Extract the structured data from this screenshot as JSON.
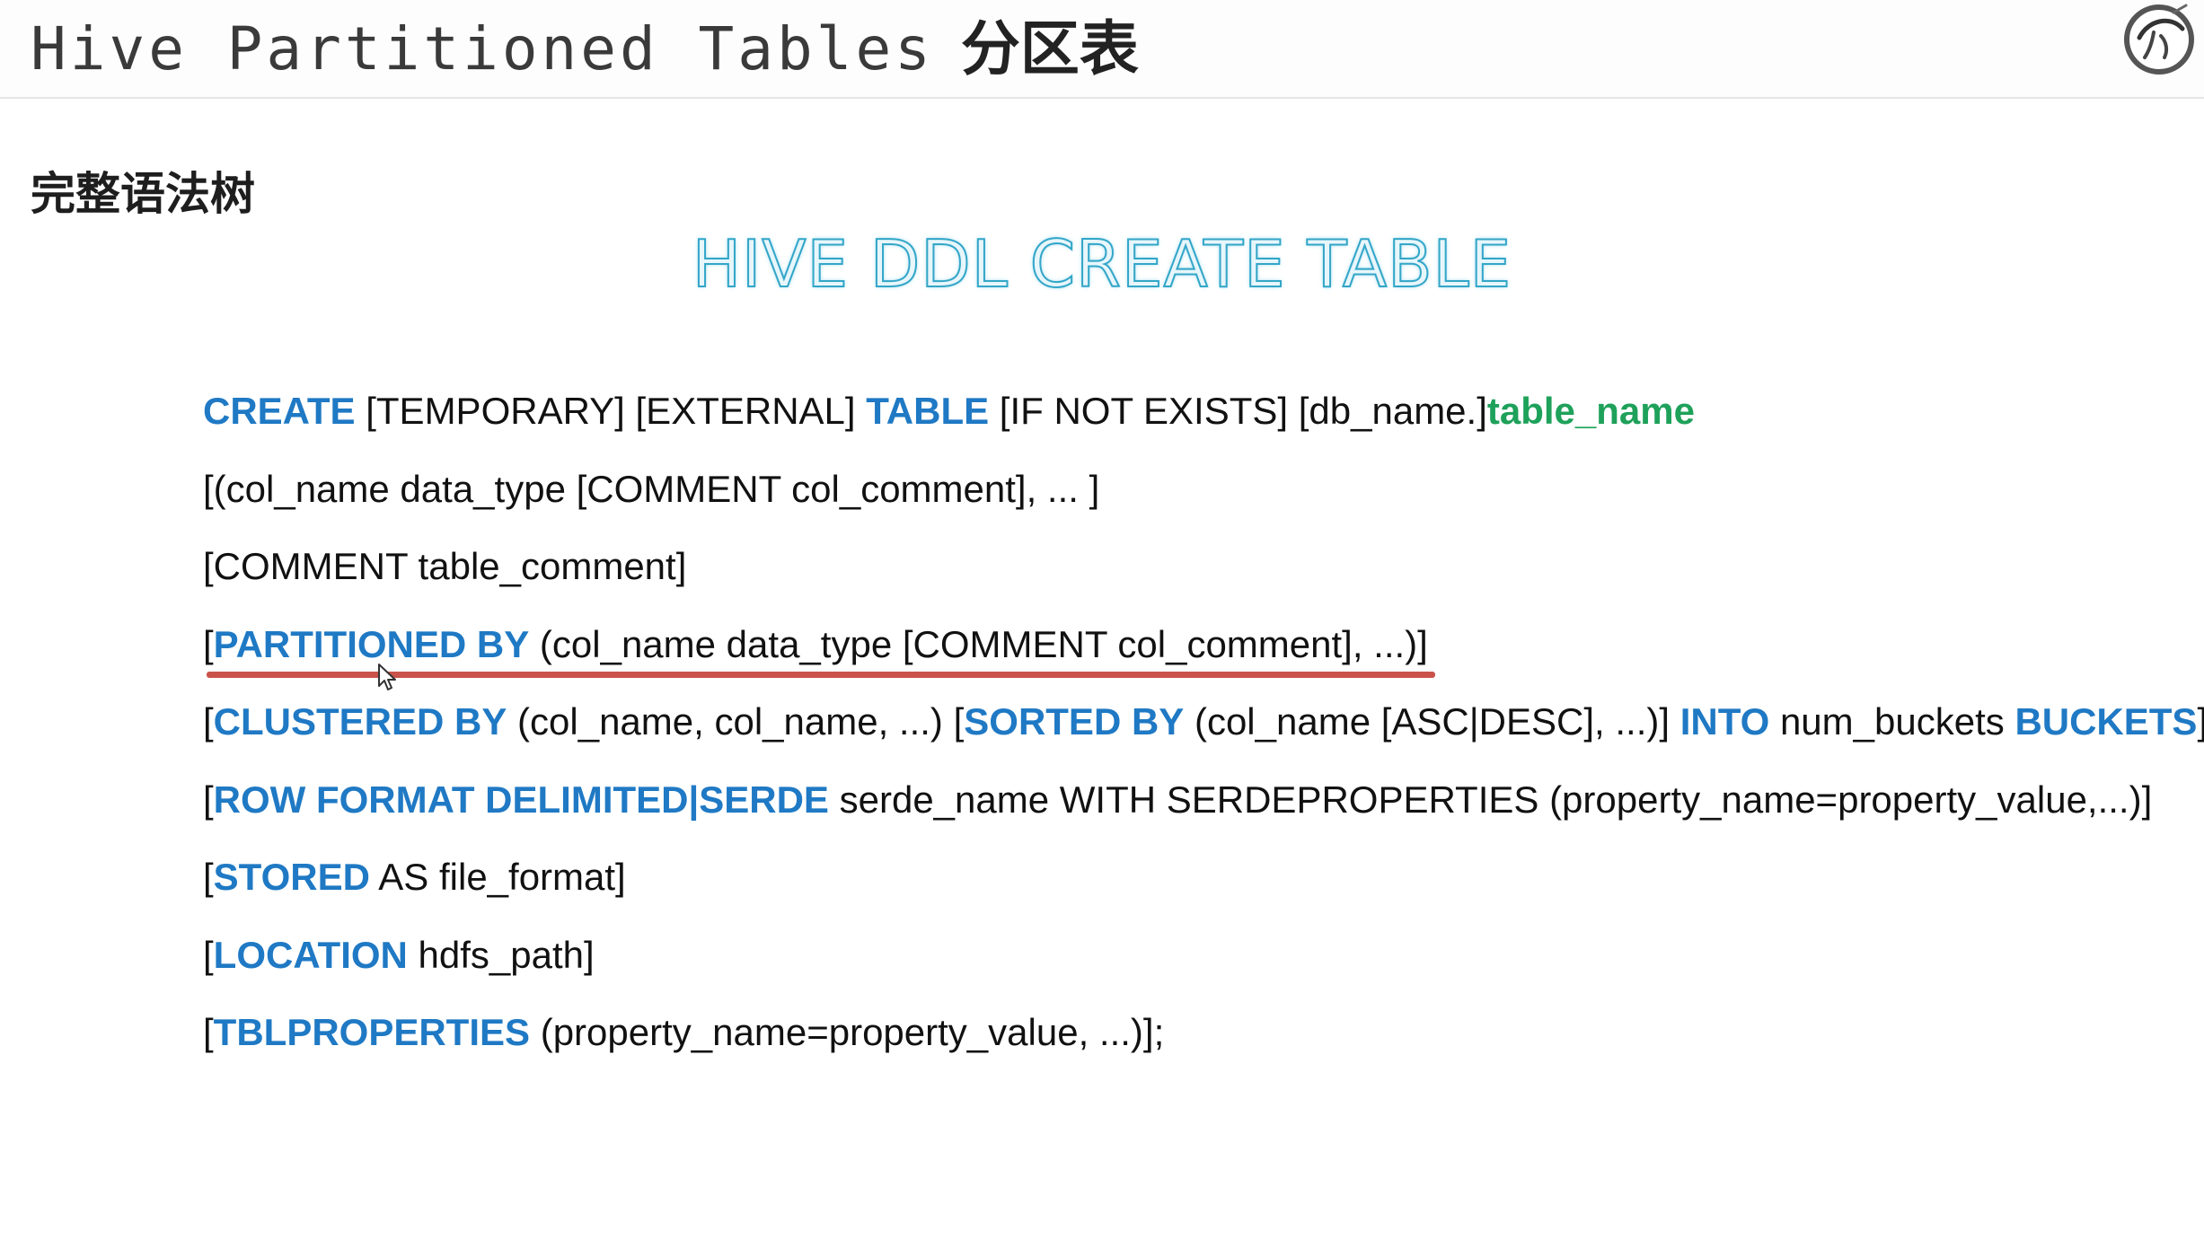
{
  "header": {
    "title_en": "Hive Partitioned Tables",
    "title_zh": "分区表",
    "logo_icon": "round-brush-logo"
  },
  "section_heading": "完整语法树",
  "big_title": "HIVE DDL CREATE TABLE",
  "colors": {
    "keyword": "#1f79c4",
    "identifier": "#1ea15a",
    "underline": "#c9534b"
  },
  "syntax": {
    "l1": {
      "create": "CREATE",
      "t1": " [TEMPORARY] [EXTERNAL] ",
      "table": "TABLE",
      "t2": " [IF NOT EXISTS] [db_name.]",
      "table_name": "table_name"
    },
    "l2": {
      "text": "[(col_name data_type [COMMENT col_comment], ... ]"
    },
    "l3": {
      "text": "[COMMENT table_comment]"
    },
    "l4": {
      "open": "[",
      "partitioned_by": "PARTITIONED BY",
      "rest": " (col_name data_type [COMMENT col_comment], ...)]"
    },
    "l5": {
      "open": "[",
      "clustered_by": "CLUSTERED BY",
      "t1": " (col_name, col_name, ...) [",
      "sorted_by": "SORTED BY",
      "t2": " (col_name [ASC|DESC], ...)] ",
      "into": "INTO",
      "t3": " num_buckets ",
      "buckets": "BUCKETS",
      "close": "]"
    },
    "l6": {
      "open": "[",
      "row_format": "ROW FORMAT DELIMITED|SERDE",
      "rest": " serde_name WITH SERDEPROPERTIES (property_name=property_value,...)]"
    },
    "l7": {
      "open": "[",
      "stored": "STORED",
      "rest": " AS file_format]"
    },
    "l8": {
      "open": "[",
      "location": "LOCATION",
      "rest": " hdfs_path]"
    },
    "l9": {
      "open": "[",
      "tblproperties": "TBLPROPERTIES",
      "rest": " (property_name=property_value, ...)];"
    }
  }
}
